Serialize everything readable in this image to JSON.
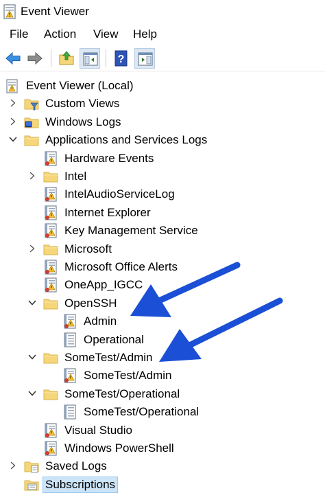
{
  "window": {
    "title": "Event Viewer",
    "icon": "event-viewer-icon"
  },
  "menu": [
    {
      "label": "File"
    },
    {
      "label": "Action"
    },
    {
      "label": "View"
    },
    {
      "label": "Help"
    }
  ],
  "toolbar": {
    "buttons": [
      "back-arrow-icon",
      "forward-arrow-icon",
      "up-folder-icon",
      "show-hide-console-tree-icon",
      "help-icon",
      "show-hide-action-pane-icon"
    ]
  },
  "tree": [
    {
      "label": "Event Viewer (Local)",
      "icon": "event-viewer-icon",
      "level": 0,
      "expander": "none"
    },
    {
      "label": "Custom Views",
      "icon": "folder-filter-icon",
      "level": 1,
      "expander": "collapsed"
    },
    {
      "label": "Windows Logs",
      "icon": "folder-windows-icon",
      "level": 1,
      "expander": "collapsed"
    },
    {
      "label": "Applications and Services Logs",
      "icon": "folder-icon",
      "level": 1,
      "expander": "expanded"
    },
    {
      "label": "Hardware Events",
      "icon": "event-log-icon",
      "level": 2,
      "expander": "none"
    },
    {
      "label": "Intel",
      "icon": "folder-icon",
      "level": 2,
      "expander": "collapsed"
    },
    {
      "label": "IntelAudioServiceLog",
      "icon": "event-log-icon",
      "level": 2,
      "expander": "none"
    },
    {
      "label": "Internet Explorer",
      "icon": "event-log-icon",
      "level": 2,
      "expander": "none"
    },
    {
      "label": "Key Management Service",
      "icon": "event-log-icon",
      "level": 2,
      "expander": "none"
    },
    {
      "label": "Microsoft",
      "icon": "folder-icon",
      "level": 2,
      "expander": "collapsed"
    },
    {
      "label": "Microsoft Office Alerts",
      "icon": "event-log-icon",
      "level": 2,
      "expander": "none"
    },
    {
      "label": "OneApp_IGCC",
      "icon": "event-log-icon",
      "level": 2,
      "expander": "none"
    },
    {
      "label": "OpenSSH",
      "icon": "folder-icon",
      "level": 2,
      "expander": "expanded"
    },
    {
      "label": "Admin",
      "icon": "event-log-icon",
      "level": 3,
      "expander": "none"
    },
    {
      "label": "Operational",
      "icon": "log-plain-icon",
      "level": 3,
      "expander": "none"
    },
    {
      "label": "SomeTest/Admin",
      "icon": "folder-icon",
      "level": 2,
      "expander": "expanded"
    },
    {
      "label": "SomeTest/Admin",
      "icon": "event-log-icon",
      "level": 3,
      "expander": "none"
    },
    {
      "label": "SomeTest/Operational",
      "icon": "folder-icon",
      "level": 2,
      "expander": "expanded"
    },
    {
      "label": "SomeTest/Operational",
      "icon": "log-plain-icon",
      "level": 3,
      "expander": "none"
    },
    {
      "label": "Visual Studio",
      "icon": "event-log-icon",
      "level": 2,
      "expander": "none"
    },
    {
      "label": "Windows PowerShell",
      "icon": "event-log-icon",
      "level": 2,
      "expander": "none"
    },
    {
      "label": "Saved Logs",
      "icon": "folder-saved-icon",
      "level": 1,
      "expander": "collapsed"
    },
    {
      "label": "Subscriptions",
      "icon": "subscriptions-icon",
      "level": 1,
      "expander": "none",
      "selected": true
    }
  ],
  "colors": {
    "annotation_arrow": "#1a4fd6",
    "selection_bg": "#cce4f7",
    "selection_border": "#99c9ef",
    "folder": "#f5d67a",
    "folder_edge": "#d9b44a"
  }
}
